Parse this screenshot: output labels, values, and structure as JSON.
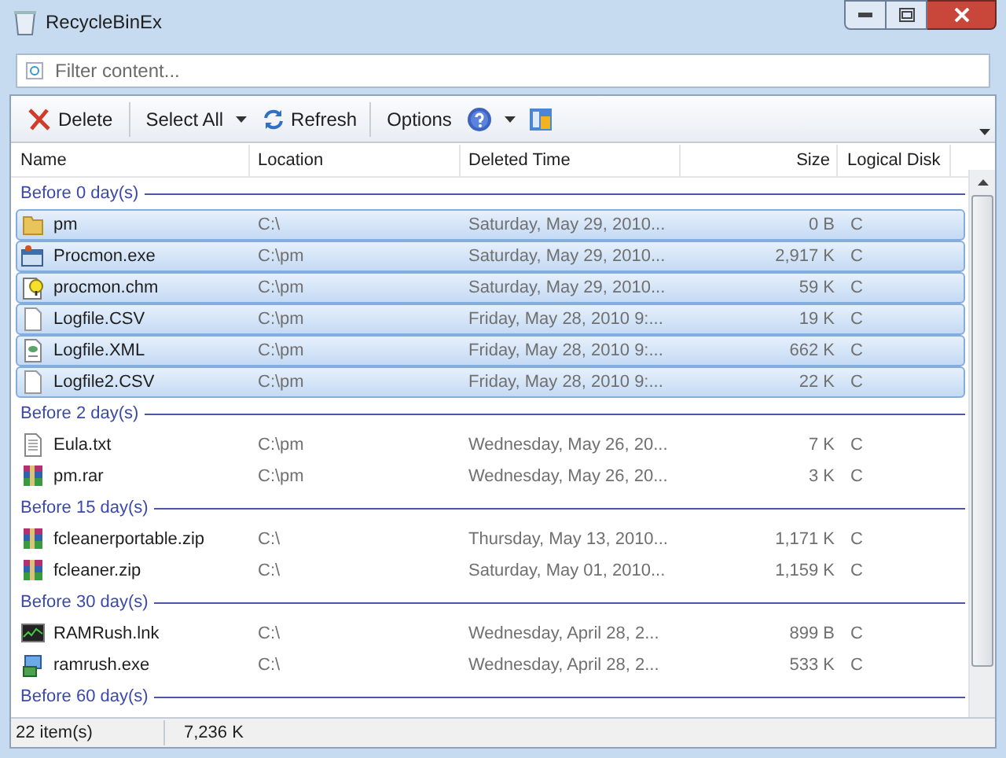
{
  "window": {
    "title": "RecycleBinEx"
  },
  "filter": {
    "placeholder": "Filter content..."
  },
  "toolbar": [
    {
      "kind": "delete",
      "label": "Delete"
    },
    {
      "kind": "separator"
    },
    {
      "kind": "dropdown",
      "label": "Select All"
    },
    {
      "kind": "refresh",
      "label": "Refresh"
    },
    {
      "kind": "separator"
    },
    {
      "kind": "text",
      "label": "Options"
    },
    {
      "kind": "help"
    },
    {
      "kind": "panel"
    }
  ],
  "columns": [
    "Name",
    "Location",
    "Deleted Time",
    "Size",
    "Logical Disk"
  ],
  "rows": [
    {
      "kind": "group",
      "label": "Before 0 day(s)"
    },
    {
      "kind": "file",
      "name": "pm",
      "location": "C:\\",
      "time": "Saturday, May 29, 2010...",
      "size": "0 B",
      "disk": "C",
      "selected": true
    },
    {
      "kind": "file",
      "name": "Procmon.exe",
      "location": "C:\\pm",
      "time": "Saturday, May 29, 2010...",
      "size": "2,917 K",
      "disk": "C",
      "selected": true
    },
    {
      "kind": "file",
      "name": "procmon.chm",
      "location": "C:\\pm",
      "time": "Saturday, May 29, 2010...",
      "size": "59 K",
      "disk": "C",
      "selected": true
    },
    {
      "kind": "file",
      "name": "Logfile.CSV",
      "location": "C:\\pm",
      "time": "Friday, May 28, 2010 9:...",
      "size": "19 K",
      "disk": "C",
      "selected": true
    },
    {
      "kind": "file",
      "name": "Logfile.XML",
      "location": "C:\\pm",
      "time": "Friday, May 28, 2010 9:...",
      "size": "662 K",
      "disk": "C",
      "selected": true
    },
    {
      "kind": "file",
      "name": "Logfile2.CSV",
      "location": "C:\\pm",
      "time": "Friday, May 28, 2010 9:...",
      "size": "22 K",
      "disk": "C",
      "selected": true
    },
    {
      "kind": "group",
      "label": "Before 2 day(s)"
    },
    {
      "kind": "file",
      "name": "Eula.txt",
      "location": "C:\\pm",
      "time": "Wednesday, May 26, 20...",
      "size": "7 K",
      "disk": "C",
      "selected": false
    },
    {
      "kind": "file",
      "name": "pm.rar",
      "location": "C:\\pm",
      "time": "Wednesday, May 26, 20...",
      "size": "3 K",
      "disk": "C",
      "selected": false
    },
    {
      "kind": "group",
      "label": "Before 15 day(s)"
    },
    {
      "kind": "file",
      "name": "fcleanerportable.zip",
      "location": "C:\\",
      "time": "Thursday, May 13, 2010...",
      "size": "1,171 K",
      "disk": "C",
      "selected": false
    },
    {
      "kind": "file",
      "name": "fcleaner.zip",
      "location": "C:\\",
      "time": "Saturday, May 01, 2010...",
      "size": "1,159 K",
      "disk": "C",
      "selected": false
    },
    {
      "kind": "group",
      "label": "Before 30 day(s)"
    },
    {
      "kind": "file",
      "name": "RAMRush.lnk",
      "location": "C:\\",
      "time": "Wednesday, April 28, 2...",
      "size": "899 B",
      "disk": "C",
      "selected": false
    },
    {
      "kind": "file",
      "name": "ramrush.exe",
      "location": "C:\\",
      "time": "Wednesday, April 28, 2...",
      "size": "533 K",
      "disk": "C",
      "selected": false
    },
    {
      "kind": "group",
      "label": "Before 60 day(s)"
    }
  ],
  "status_bar": [
    "22 item(s)",
    "7,236 K"
  ]
}
